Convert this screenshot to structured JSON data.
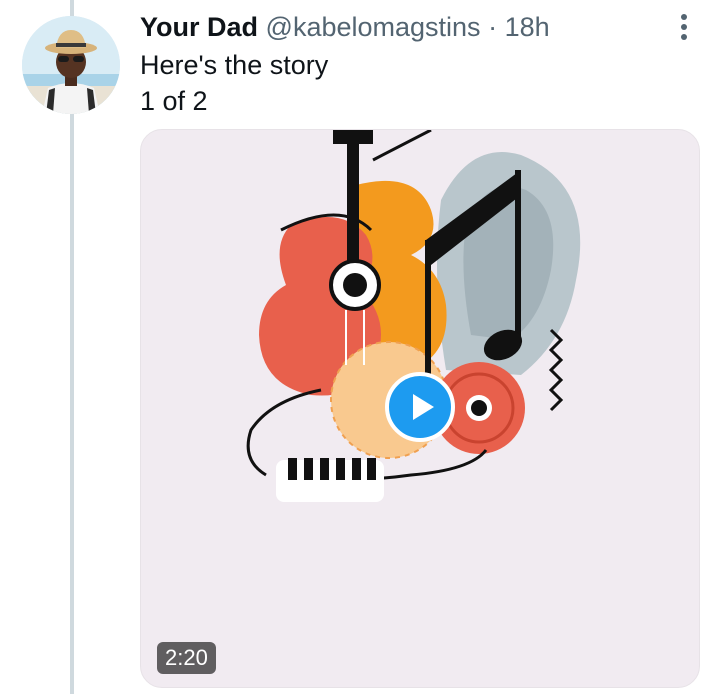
{
  "tweet": {
    "display_name": "Your Dad",
    "handle": "@kabelomagstins",
    "separator": "·",
    "time": "18h",
    "text": "Here's the story",
    "thread_position": "1 of 2"
  },
  "media": {
    "duration": "2:20",
    "play_icon": "play-icon",
    "colors": {
      "background": "#f1ebf1",
      "play_button": "#1d9bf0",
      "coral": "#e8604c",
      "orange": "#f39a1e",
      "peach": "#f9c98f",
      "grey_blue": "#b9c6cc",
      "black": "#111111"
    }
  },
  "icons": {
    "more": "more-options-icon",
    "avatar": "avatar"
  }
}
